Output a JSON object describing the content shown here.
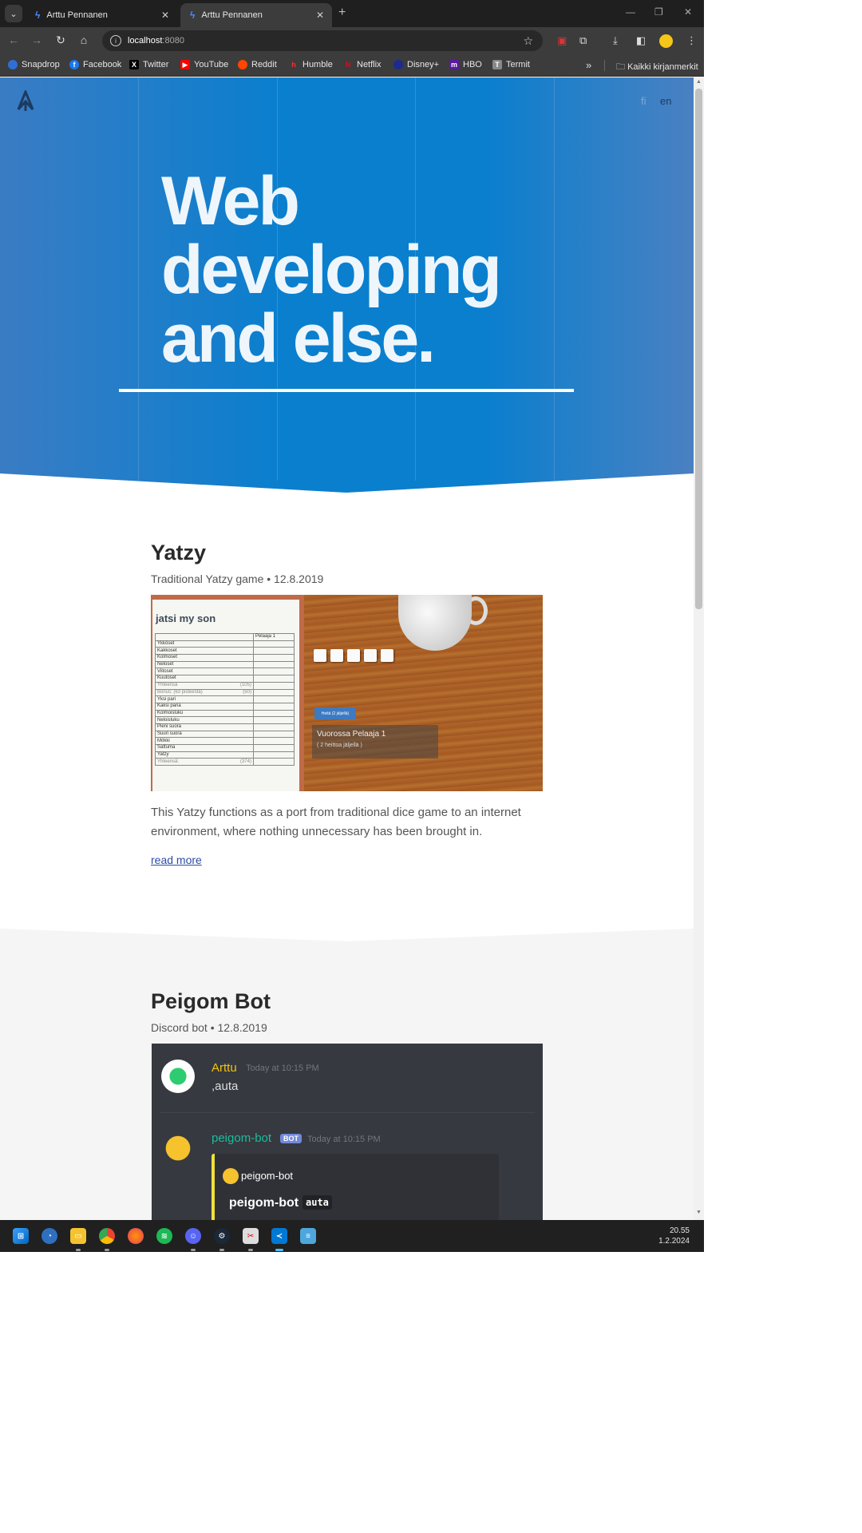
{
  "browser": {
    "tabs": [
      {
        "title": "Arttu Pennanen",
        "active": false
      },
      {
        "title": "Arttu Pennanen",
        "active": true
      }
    ],
    "url_host": "localhost",
    "url_port": ":8080",
    "bookmarks": [
      "Snapdrop",
      "Facebook",
      "Twitter",
      "YouTube",
      "Reddit",
      "Humble",
      "Netflix",
      "Disney+",
      "HBO",
      "Termit"
    ],
    "all_bookmarks": "Kaikki kirjanmerkit"
  },
  "page": {
    "lang_fi": "fi",
    "lang_en": "en",
    "hero_title": "Web developing and else.",
    "posts": [
      {
        "title": "Yatzy",
        "meta": "Traditional Yatzy game • 12.8.2019",
        "text": "This Yatzy functions as a port from traditional dice game to an internet environment, where nothing unnecessary has been brought in.",
        "link": "read more"
      },
      {
        "title": "Peigom Bot",
        "meta": "Discord bot • 12.8.2019"
      }
    ],
    "yatzy_image": {
      "sheet_title": "jatsi my son",
      "player_header": "Pelaaja 1",
      "rows": [
        "Ykköset",
        "Kakkoset",
        "Kolmoset",
        "Neloset",
        "Viitoset",
        "Kuutoset",
        "Yhteensä",
        "Bonus: (63 pisteestä)",
        "Yksi pari",
        "Kaksi paria",
        "Kolmoisluku",
        "Neloisluku",
        "Pieni suora",
        "Suuri suora",
        "Mökki",
        "Sattuma",
        "Yatzy",
        "Yhteensä:"
      ],
      "row_values": [
        "",
        "",
        "",
        "",
        "",
        "",
        "(105)",
        "(50)",
        "",
        "",
        "",
        "",
        "",
        "",
        "",
        "",
        "",
        "(374)"
      ],
      "throw_button": "Heitä (2 jäljellä)",
      "turn_text": "Vuorossa Pelaaja 1",
      "turn_sub": "( 2 heittoa jäljellä )"
    },
    "discord_image": {
      "user1": "Arttu",
      "time1": "Today at 10:15 PM",
      "msg1": ",auta",
      "user2": "peigom-bot",
      "badge": "BOT",
      "time2": "Today at 10:15 PM",
      "embed_author": "peigom-bot",
      "embed_title": "peigom-bot",
      "embed_code": "auta"
    }
  },
  "taskbar": {
    "time": "20.55",
    "date": "1.2.2024"
  },
  "colors": {
    "hero_blue": "#0a7fce",
    "link": "#2b4fa3",
    "discord_bg": "#36393f",
    "arttu_name": "#f1c40f",
    "bot_name": "#1abc9c"
  }
}
